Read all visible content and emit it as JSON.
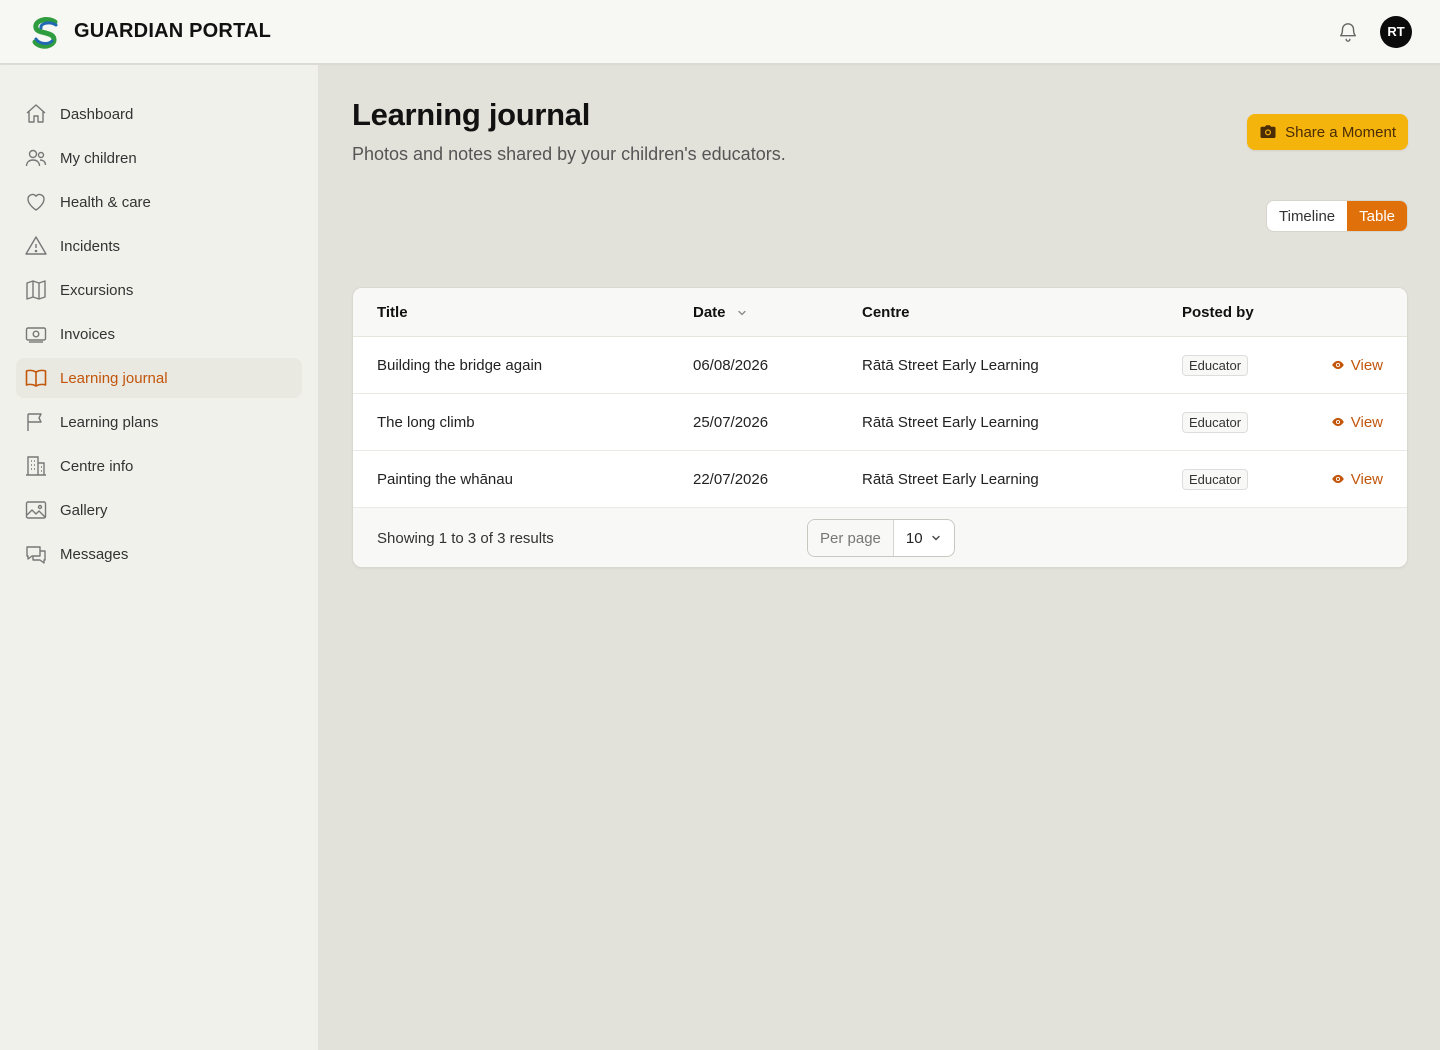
{
  "app": {
    "name": "GUARDIAN PORTAL",
    "user_initials": "RT"
  },
  "sidebar": {
    "items": [
      {
        "label": "Dashboard",
        "icon": "home-icon"
      },
      {
        "label": "My children",
        "icon": "users-icon"
      },
      {
        "label": "Health & care",
        "icon": "heart-icon"
      },
      {
        "label": "Incidents",
        "icon": "warning-icon"
      },
      {
        "label": "Excursions",
        "icon": "map-icon"
      },
      {
        "label": "Invoices",
        "icon": "banknote-icon"
      },
      {
        "label": "Learning journal",
        "icon": "book-open-icon",
        "active": true
      },
      {
        "label": "Learning plans",
        "icon": "flag-icon"
      },
      {
        "label": "Centre info",
        "icon": "building-icon"
      },
      {
        "label": "Gallery",
        "icon": "image-icon"
      },
      {
        "label": "Messages",
        "icon": "chat-icon"
      }
    ]
  },
  "page": {
    "title": "Learning journal",
    "subtitle": "Photos and notes shared by your children's educators.",
    "share_button": "Share a Moment",
    "view_toggle": {
      "timeline": "Timeline",
      "table": "Table",
      "selected": "Table"
    }
  },
  "table": {
    "columns": {
      "title": "Title",
      "date": "Date",
      "centre": "Centre",
      "posted_by": "Posted by"
    },
    "rows": [
      {
        "title": "Building the bridge again",
        "date": "06/08/2026",
        "centre": "Rātā Street Early Learning",
        "posted_by": "Educator",
        "action": "View"
      },
      {
        "title": "The long climb",
        "date": "25/07/2026",
        "centre": "Rātā Street Early Learning",
        "posted_by": "Educator",
        "action": "View"
      },
      {
        "title": "Painting the whānau",
        "date": "22/07/2026",
        "centre": "Rātā Street Early Learning",
        "posted_by": "Educator",
        "action": "View"
      }
    ],
    "footer": {
      "results": "Showing 1 to 3 of 3 results",
      "per_page_label": "Per page",
      "per_page_value": "10"
    }
  },
  "colors": {
    "accent": "#c2560b",
    "toggle_active": "#e0710a",
    "share_button": "#f5b40c"
  }
}
